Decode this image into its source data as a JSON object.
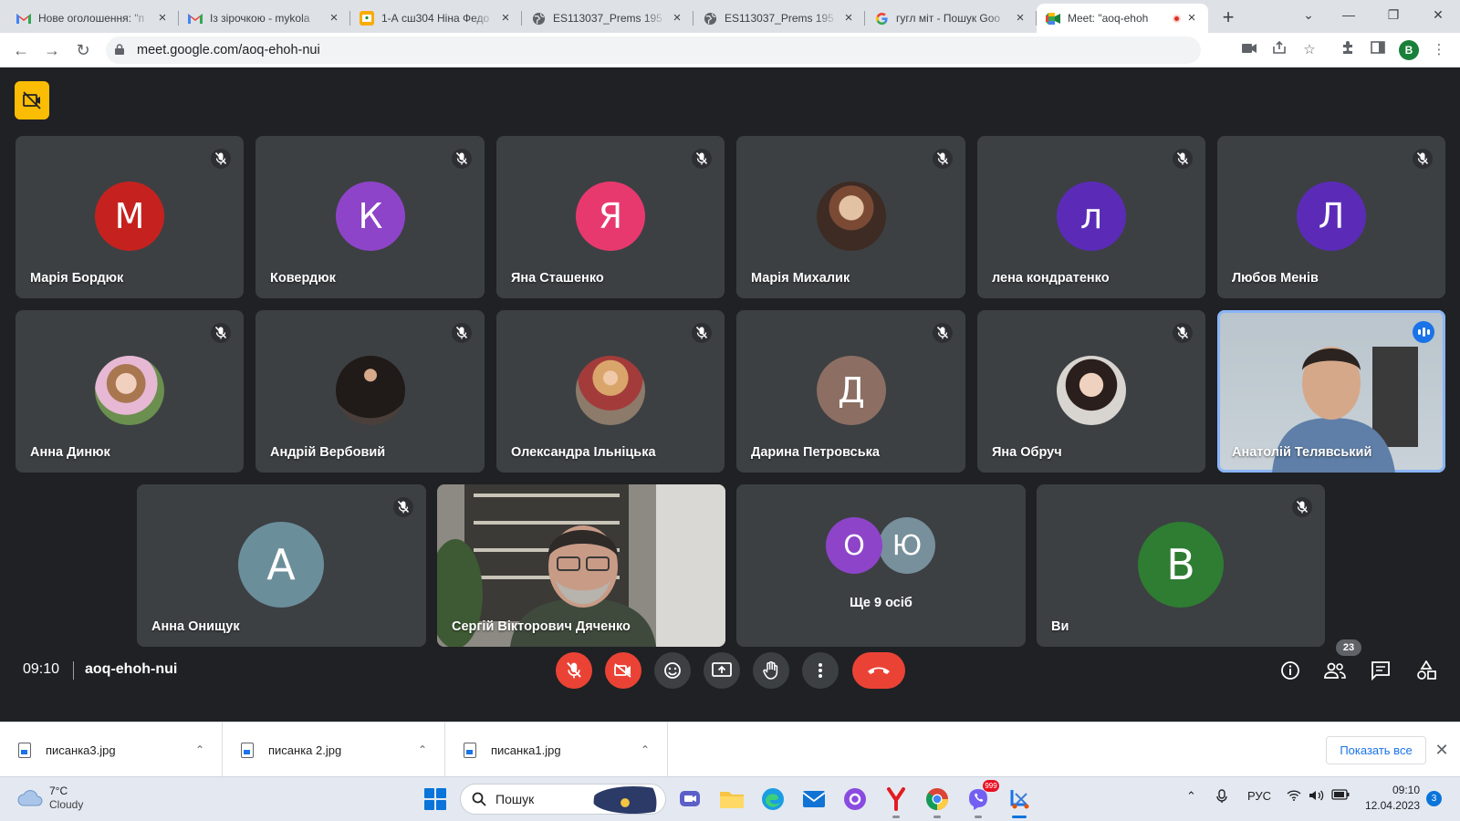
{
  "browser": {
    "tabs": [
      {
        "title": "Нове оголошення: \"п",
        "favicon": "gmail-icon",
        "active": false
      },
      {
        "title": "Із зірочкою - mykola",
        "favicon": "gmail-icon",
        "active": false
      },
      {
        "title": "1-А сш304 Ніна Федо",
        "favicon": "classroom-icon",
        "active": false
      },
      {
        "title": "ES113037_Prems 195",
        "favicon": "globe-icon",
        "active": false
      },
      {
        "title": "ES113037_Prems 195",
        "favicon": "globe-icon",
        "active": false
      },
      {
        "title": "гугл міт - Пошук Goo",
        "favicon": "google-icon",
        "active": false
      },
      {
        "title": "Meet: \"aoq-ehoh",
        "favicon": "meet-icon",
        "active": true,
        "recording": true
      }
    ],
    "url": "meet.google.com/aoq-ehoh-nui",
    "profile_letter": "B"
  },
  "meet": {
    "participants": [
      {
        "name": "Марія Бордюк",
        "initial": "М",
        "color": "#c5221f",
        "muted": true
      },
      {
        "name": "Ковердюк",
        "initial": "К",
        "color": "#8e44c8",
        "muted": true
      },
      {
        "name": "Яна Сташенко",
        "initial": "Я",
        "color": "#e8396f",
        "muted": true
      },
      {
        "name": "Марія Михалик",
        "initial": "",
        "photo": true,
        "muted": true
      },
      {
        "name": "лена кондратенко",
        "initial": "л",
        "color": "#5b2bb8",
        "muted": true
      },
      {
        "name": "Любов Менів",
        "initial": "Л",
        "color": "#5b2bb8",
        "muted": true
      },
      {
        "name": "Анна Динюк",
        "initial": "",
        "photo": true,
        "muted": true
      },
      {
        "name": "Андрій Вербовий",
        "initial": "",
        "photo": true,
        "muted": true
      },
      {
        "name": "Олександра Ільніцька",
        "initial": "",
        "photo": true,
        "muted": true
      },
      {
        "name": "Дарина Петровська",
        "initial": "Д",
        "color": "#8d6e63",
        "muted": true
      },
      {
        "name": "Яна Обруч",
        "initial": "",
        "photo": true,
        "muted": true
      },
      {
        "name": "Анатолій Телявський",
        "video": true,
        "speaking": true
      },
      {
        "name": "Анна Онищук",
        "initial": "А",
        "color": "#6b8e9b",
        "muted": true
      },
      {
        "name": "Сергій Вікторович Дяченко",
        "video": true
      },
      {
        "others_label": "Ще 9 осіб",
        "initials": [
          "О",
          "Ю"
        ],
        "colors": [
          "#8e44c8",
          "#78909c"
        ]
      },
      {
        "name": "Ви",
        "initial": "B",
        "color": "#2e7d32",
        "muted": true
      }
    ],
    "time": "09:10",
    "meeting_code": "aoq-ehoh-nui",
    "people_count": "23"
  },
  "downloads": {
    "items": [
      {
        "filename": "писанка3.jpg"
      },
      {
        "filename": "писанка 2.jpg"
      },
      {
        "filename": "писанка1.jpg"
      }
    ],
    "show_all": "Показать все"
  },
  "taskbar": {
    "weather_temp": "7°C",
    "weather_condition": "Cloudy",
    "search_placeholder": "Пошук",
    "viber_badge": "999",
    "language": "РУС",
    "clock_time": "09:10",
    "clock_date": "12.04.2023",
    "notification_count": "3"
  }
}
